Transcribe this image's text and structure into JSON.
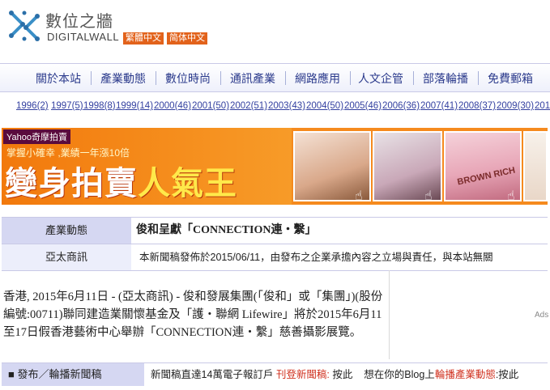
{
  "header": {
    "brand_cn": "數位之牆",
    "brand_en": "DIGITALWALL",
    "lang_traditional": "繁體中文",
    "lang_simplified": "简体中文",
    "accent": "#e2621b"
  },
  "nav": {
    "items": [
      "關於本站",
      "產業動態",
      "數位時尚",
      "通訊產業",
      "網路應用",
      "人文企管",
      "部落輪播",
      "免費郵箱"
    ]
  },
  "years": [
    "1996(2)",
    "1997(5)",
    "1998(8)",
    "1999(14)",
    "2000(46)",
    "2001(50)",
    "2002(51)",
    "2003(43)",
    "2004(50)",
    "2005(46)",
    "2006(36)",
    "2007(41)",
    "2008(37)",
    "2009(30)",
    "201"
  ],
  "banner": {
    "tag": "Yahoo奇摩拍賣",
    "sub": "掌握小確幸 ,業績一年漲10倍",
    "headline_a": "變身拍賣",
    "headline_b": "人氣王",
    "shirt_text": "BROWN RICH"
  },
  "article": {
    "category": "產業動態",
    "title": "俊和呈獻「CONNECTION連‧繫」",
    "source": "亞太商訊",
    "disclaimer": "本新聞稿發佈於2015/06/11，由發布之企業承擔內容之立場與責任，與本站無關",
    "body": "香港, 2015年6月11日 - (亞太商訊) - 俊和發展集團(「俊和」或「集團」)(股份編號:00711)聯同建造業關懷基金及「護‧聯網 Lifewire」將於2015年6月11至17日假香港藝術中心舉辦「CONNECTION連‧繫」慈善攝影展覽。",
    "ad_label": "Ads"
  },
  "footer": {
    "left": "■ 發布／輪播新聞稿",
    "t1": "新聞稿直達14萬電子報訂戶",
    "t2": "刊登新聞稿:",
    "t3": "按此",
    "t4": "想在你的Blog上",
    "t5": "輪播產業動態",
    "t6": ":按此"
  }
}
